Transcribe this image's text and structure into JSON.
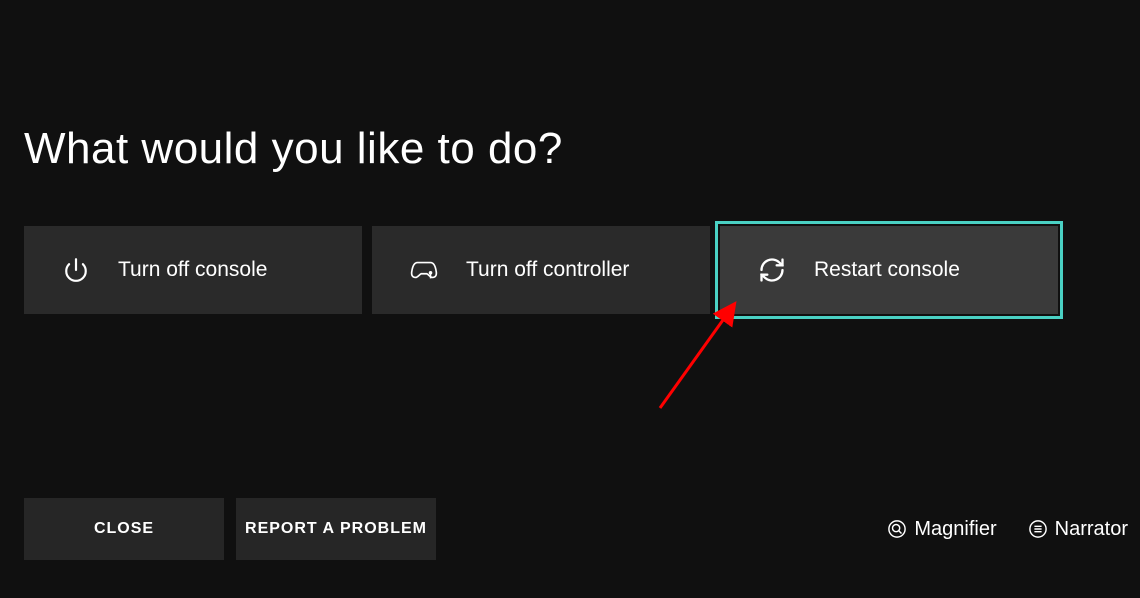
{
  "title": "What would you like to do?",
  "options": {
    "turn_off_console": "Turn off console",
    "turn_off_controller": "Turn off controller",
    "restart_console": "Restart console"
  },
  "buttons": {
    "close": "CLOSE",
    "report": "REPORT A PROBLEM"
  },
  "accessibility": {
    "magnifier": "Magnifier",
    "narrator": "Narrator"
  },
  "colors": {
    "focus_ring": "#4ad1c4",
    "annotation_arrow": "#ff0000"
  }
}
